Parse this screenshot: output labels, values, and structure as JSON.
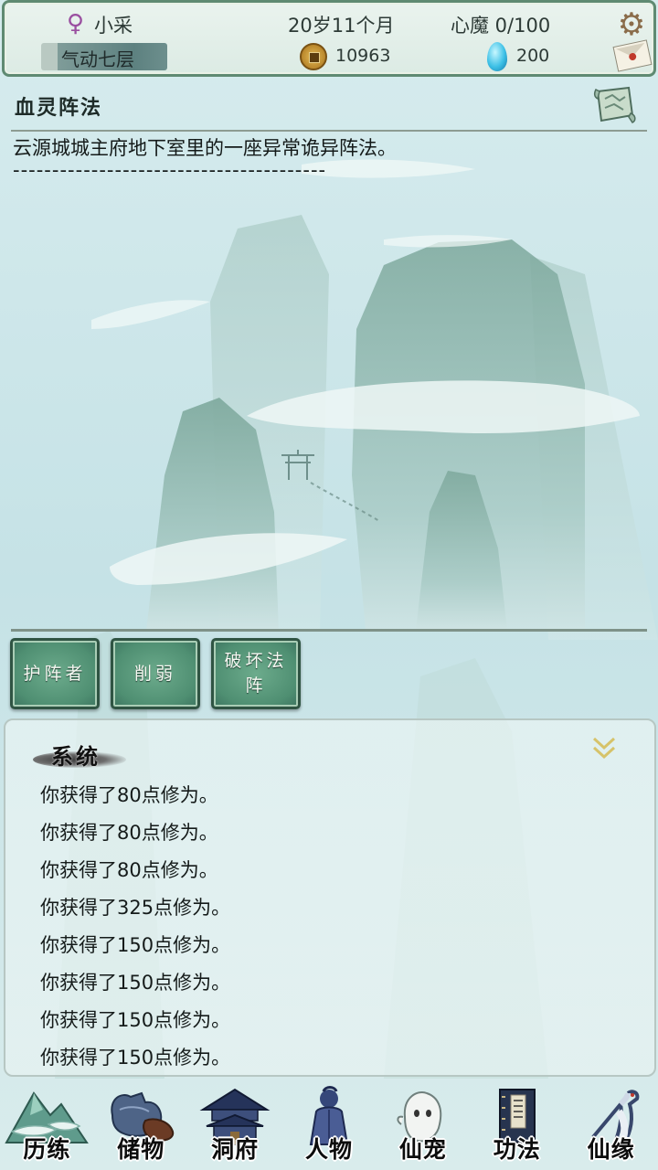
{
  "status_bar": {
    "gender_symbol": "♀",
    "player_name": "小采",
    "realm": "气动七层",
    "age": "20岁11个月",
    "heart_demon": "心魔  0/100",
    "coins": "10963",
    "gems": "200",
    "icons": [
      "female-icon",
      "coin-icon",
      "spirit-gem-icon",
      "settings-gear-icon",
      "mail-icon"
    ]
  },
  "formation": {
    "title": "血灵阵法",
    "description": "云源城城主府地下室里的一座异常诡异阵法。",
    "divider": "----------------------------------------"
  },
  "actions": [
    {
      "label": "护阵者"
    },
    {
      "label": "削弱"
    },
    {
      "label": "破坏法阵"
    }
  ],
  "system_log": {
    "title": "系统",
    "messages": [
      "你获得了80点修为。",
      "你获得了80点修为。",
      "你获得了80点修为。",
      "你获得了325点修为。",
      "你获得了150点修为。",
      "你获得了150点修为。",
      "你获得了150点修为。",
      "你获得了150点修为。"
    ]
  },
  "bottom_nav": [
    {
      "label": "历练",
      "icon": "mountain-icon"
    },
    {
      "label": "储物",
      "icon": "pouch-icon"
    },
    {
      "label": "洞府",
      "icon": "pavilion-icon"
    },
    {
      "label": "人物",
      "icon": "person-icon"
    },
    {
      "label": "仙宠",
      "icon": "pet-ghost-icon"
    },
    {
      "label": "功法",
      "icon": "manual-book-icon"
    },
    {
      "label": "仙缘",
      "icon": "crane-icon"
    }
  ],
  "colors": {
    "background": "#cfe6e8",
    "frame_green": "#5f8a72",
    "button_green": "#4f8f72",
    "gender_purple": "#9a4fa0"
  }
}
